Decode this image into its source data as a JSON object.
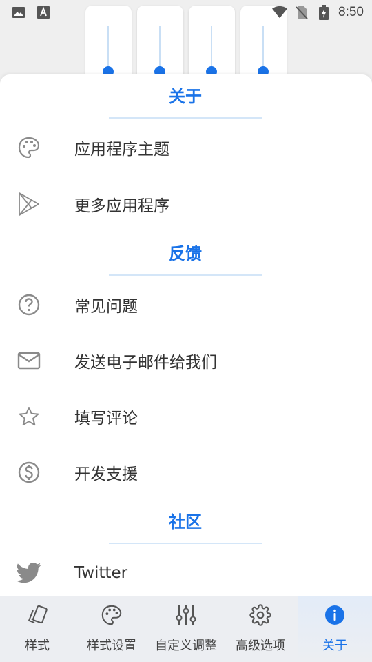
{
  "status_bar": {
    "time": "8:50"
  },
  "sections": [
    {
      "title": "关于",
      "items": [
        {
          "label": "应用程序主题",
          "icon": "palette-icon"
        },
        {
          "label": "更多应用程序",
          "icon": "play-store-icon"
        }
      ]
    },
    {
      "title": "反馈",
      "items": [
        {
          "label": "常见问题",
          "icon": "help-circle-icon"
        },
        {
          "label": "发送电子邮件给我们",
          "icon": "mail-icon"
        },
        {
          "label": "填写评论",
          "icon": "star-icon"
        },
        {
          "label": "开发支援",
          "icon": "dollar-circle-icon"
        }
      ]
    },
    {
      "title": "社区",
      "items": [
        {
          "label": "Twitter",
          "icon": "twitter-icon"
        }
      ]
    }
  ],
  "bottom_nav": {
    "items": [
      {
        "label": "样式",
        "icon": "style-icon",
        "active": false
      },
      {
        "label": "样式设置",
        "icon": "palette-icon",
        "active": false
      },
      {
        "label": "自定义调整",
        "icon": "equalizer-icon",
        "active": false
      },
      {
        "label": "高级选项",
        "icon": "gear-icon",
        "active": false
      },
      {
        "label": "关于",
        "icon": "info-icon",
        "active": true
      }
    ]
  },
  "colors": {
    "accent": "#1a73e8",
    "divider": "#d4e6f8",
    "icon": "#8a8a8a"
  }
}
